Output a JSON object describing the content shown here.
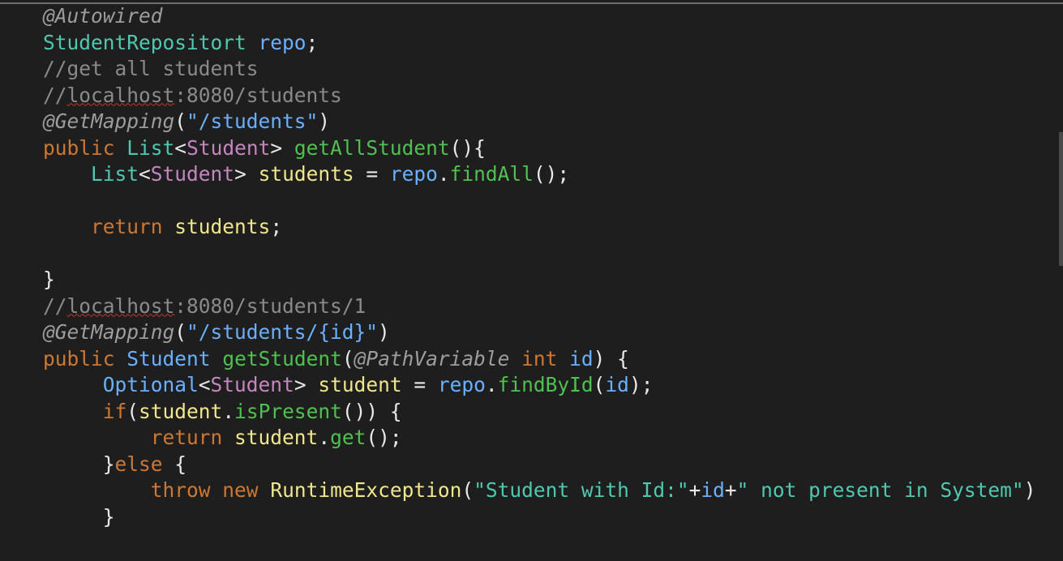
{
  "editor": {
    "lines": [
      [
        {
          "t": "@Autowired",
          "c": "ann"
        }
      ],
      [
        {
          "t": "StudentRepositort",
          "c": "typ"
        },
        {
          "t": " ",
          "c": "pun"
        },
        {
          "t": "repo",
          "c": "var"
        },
        {
          "t": ";",
          "c": "pun"
        }
      ],
      [
        {
          "t": "//get all students",
          "c": "cmt"
        }
      ],
      [
        {
          "t": "//",
          "c": "cmt"
        },
        {
          "t": "localhost",
          "c": "cmt sq"
        },
        {
          "t": ":8080/students",
          "c": "cmt"
        }
      ],
      [
        {
          "t": "@GetMapping",
          "c": "ann"
        },
        {
          "t": "(",
          "c": "pun"
        },
        {
          "t": "\"/students\"",
          "c": "str"
        },
        {
          "t": ")",
          "c": "pun"
        }
      ],
      [
        {
          "t": "public",
          "c": "kw"
        },
        {
          "t": " ",
          "c": "pun"
        },
        {
          "t": "List",
          "c": "typ"
        },
        {
          "t": "<",
          "c": "pun"
        },
        {
          "t": "Student",
          "c": "gen"
        },
        {
          "t": "> ",
          "c": "pun"
        },
        {
          "t": "getAllStudent",
          "c": "mth"
        },
        {
          "t": "(){",
          "c": "pun"
        }
      ],
      [
        {
          "t": "    ",
          "c": "pun"
        },
        {
          "t": "List",
          "c": "typ"
        },
        {
          "t": "<",
          "c": "pun"
        },
        {
          "t": "Student",
          "c": "gen"
        },
        {
          "t": "> ",
          "c": "pun"
        },
        {
          "t": "students",
          "c": "loc"
        },
        {
          "t": " = ",
          "c": "pun"
        },
        {
          "t": "repo",
          "c": "var"
        },
        {
          "t": ".",
          "c": "pun"
        },
        {
          "t": "findAll",
          "c": "mth"
        },
        {
          "t": "();",
          "c": "pun"
        }
      ],
      [],
      [
        {
          "t": "    ",
          "c": "pun"
        },
        {
          "t": "return",
          "c": "kw"
        },
        {
          "t": " ",
          "c": "pun"
        },
        {
          "t": "students",
          "c": "loc"
        },
        {
          "t": ";",
          "c": "pun"
        }
      ],
      [],
      [
        {
          "t": "}",
          "c": "pun"
        }
      ],
      [
        {
          "t": "//",
          "c": "cmt"
        },
        {
          "t": "localhost",
          "c": "cmt sq"
        },
        {
          "t": ":8080/students/1",
          "c": "cmt"
        }
      ],
      [
        {
          "t": "@GetMapping",
          "c": "ann"
        },
        {
          "t": "(",
          "c": "pun"
        },
        {
          "t": "\"/students/{id}\"",
          "c": "str"
        },
        {
          "t": ")",
          "c": "pun"
        }
      ],
      [
        {
          "t": "public",
          "c": "kw"
        },
        {
          "t": " ",
          "c": "pun"
        },
        {
          "t": "Student",
          "c": "var"
        },
        {
          "t": " ",
          "c": "pun"
        },
        {
          "t": "getStudent",
          "c": "mth"
        },
        {
          "t": "(",
          "c": "pun"
        },
        {
          "t": "@PathVariable",
          "c": "ann"
        },
        {
          "t": " ",
          "c": "pun"
        },
        {
          "t": "int",
          "c": "kw"
        },
        {
          "t": " ",
          "c": "pun"
        },
        {
          "t": "id",
          "c": "param"
        },
        {
          "t": ") {",
          "c": "pun"
        }
      ],
      [
        {
          "t": "     ",
          "c": "pun"
        },
        {
          "t": "Optional",
          "c": "var"
        },
        {
          "t": "<",
          "c": "pun"
        },
        {
          "t": "Student",
          "c": "gen"
        },
        {
          "t": "> ",
          "c": "pun"
        },
        {
          "t": "student",
          "c": "loc"
        },
        {
          "t": " = ",
          "c": "pun"
        },
        {
          "t": "repo",
          "c": "var"
        },
        {
          "t": ".",
          "c": "pun"
        },
        {
          "t": "findById",
          "c": "mth"
        },
        {
          "t": "(",
          "c": "pun"
        },
        {
          "t": "id",
          "c": "param"
        },
        {
          "t": ");",
          "c": "pun"
        }
      ],
      [
        {
          "t": "     ",
          "c": "pun"
        },
        {
          "t": "if",
          "c": "kw"
        },
        {
          "t": "(",
          "c": "pun"
        },
        {
          "t": "student",
          "c": "loc"
        },
        {
          "t": ".",
          "c": "pun"
        },
        {
          "t": "isPresent",
          "c": "mth"
        },
        {
          "t": "()) {",
          "c": "pun"
        }
      ],
      [
        {
          "t": "         ",
          "c": "pun"
        },
        {
          "t": "return",
          "c": "kw"
        },
        {
          "t": " ",
          "c": "pun"
        },
        {
          "t": "student",
          "c": "loc"
        },
        {
          "t": ".",
          "c": "pun"
        },
        {
          "t": "get",
          "c": "mth"
        },
        {
          "t": "();",
          "c": "pun"
        }
      ],
      [
        {
          "t": "     ",
          "c": "pun"
        },
        {
          "t": "}",
          "c": "pun"
        },
        {
          "t": "else",
          "c": "kw"
        },
        {
          "t": " {",
          "c": "pun"
        }
      ],
      [
        {
          "t": "         ",
          "c": "pun"
        },
        {
          "t": "throw",
          "c": "kw"
        },
        {
          "t": " ",
          "c": "pun"
        },
        {
          "t": "new",
          "c": "kw"
        },
        {
          "t": " ",
          "c": "pun"
        },
        {
          "t": "RuntimeException",
          "c": "loc"
        },
        {
          "t": "(",
          "c": "pun"
        },
        {
          "t": "\"Student with Id:\"",
          "c": "txt"
        },
        {
          "t": "+",
          "c": "pun"
        },
        {
          "t": "id",
          "c": "param"
        },
        {
          "t": "+",
          "c": "pun"
        },
        {
          "t": "\" not present in System\"",
          "c": "txt"
        },
        {
          "t": ")",
          "c": "pun"
        }
      ],
      [
        {
          "t": "     ",
          "c": "pun"
        },
        {
          "t": "}",
          "c": "pun"
        }
      ]
    ]
  },
  "colors": {
    "background": "#1e1e1e",
    "annotation": "#9d9d9d",
    "comment": "#8a8a8a",
    "type": "#4ec9b0",
    "variable": "#6ab0ff",
    "keyword": "#cc7832",
    "generic": "#c586c0",
    "method": "#4fc14f",
    "local": "#f0e68c",
    "punctuation": "#e8e8e8"
  }
}
